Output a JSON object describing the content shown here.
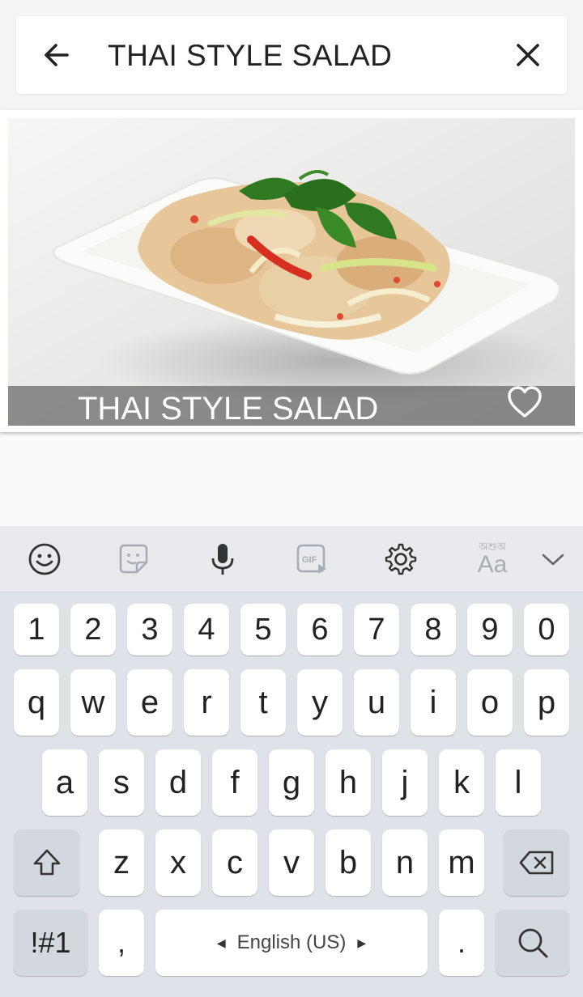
{
  "search": {
    "query": "THAI STYLE SALAD",
    "back_icon": "arrow-left-icon",
    "clear_icon": "close-icon"
  },
  "result_card": {
    "title": "THAI STYLE SALAD",
    "favorite_icon": "heart-outline-icon"
  },
  "keyboard": {
    "toolbar": {
      "items": [
        "emoji-icon",
        "sticker-icon",
        "microphone-icon",
        "gif-icon",
        "settings-icon",
        "language-aa-icon",
        "collapse-icon"
      ],
      "lang_script_label": "অশুঅ",
      "lang_aa_label": "Aa"
    },
    "rows": {
      "numbers": [
        "1",
        "2",
        "3",
        "4",
        "5",
        "6",
        "7",
        "8",
        "9",
        "0"
      ],
      "row1": [
        "q",
        "w",
        "e",
        "r",
        "t",
        "y",
        "u",
        "i",
        "o",
        "p"
      ],
      "row2": [
        "a",
        "s",
        "d",
        "f",
        "g",
        "h",
        "j",
        "k",
        "l"
      ],
      "row3": [
        "z",
        "x",
        "c",
        "v",
        "b",
        "n",
        "m"
      ]
    },
    "symbols_label": "!#1",
    "comma_label": ",",
    "space_label": "English (US)",
    "period_label": ".",
    "colors": {
      "background": "#dfe2e8",
      "key": "#ffffff",
      "modifier_key": "#d3d7de"
    }
  }
}
